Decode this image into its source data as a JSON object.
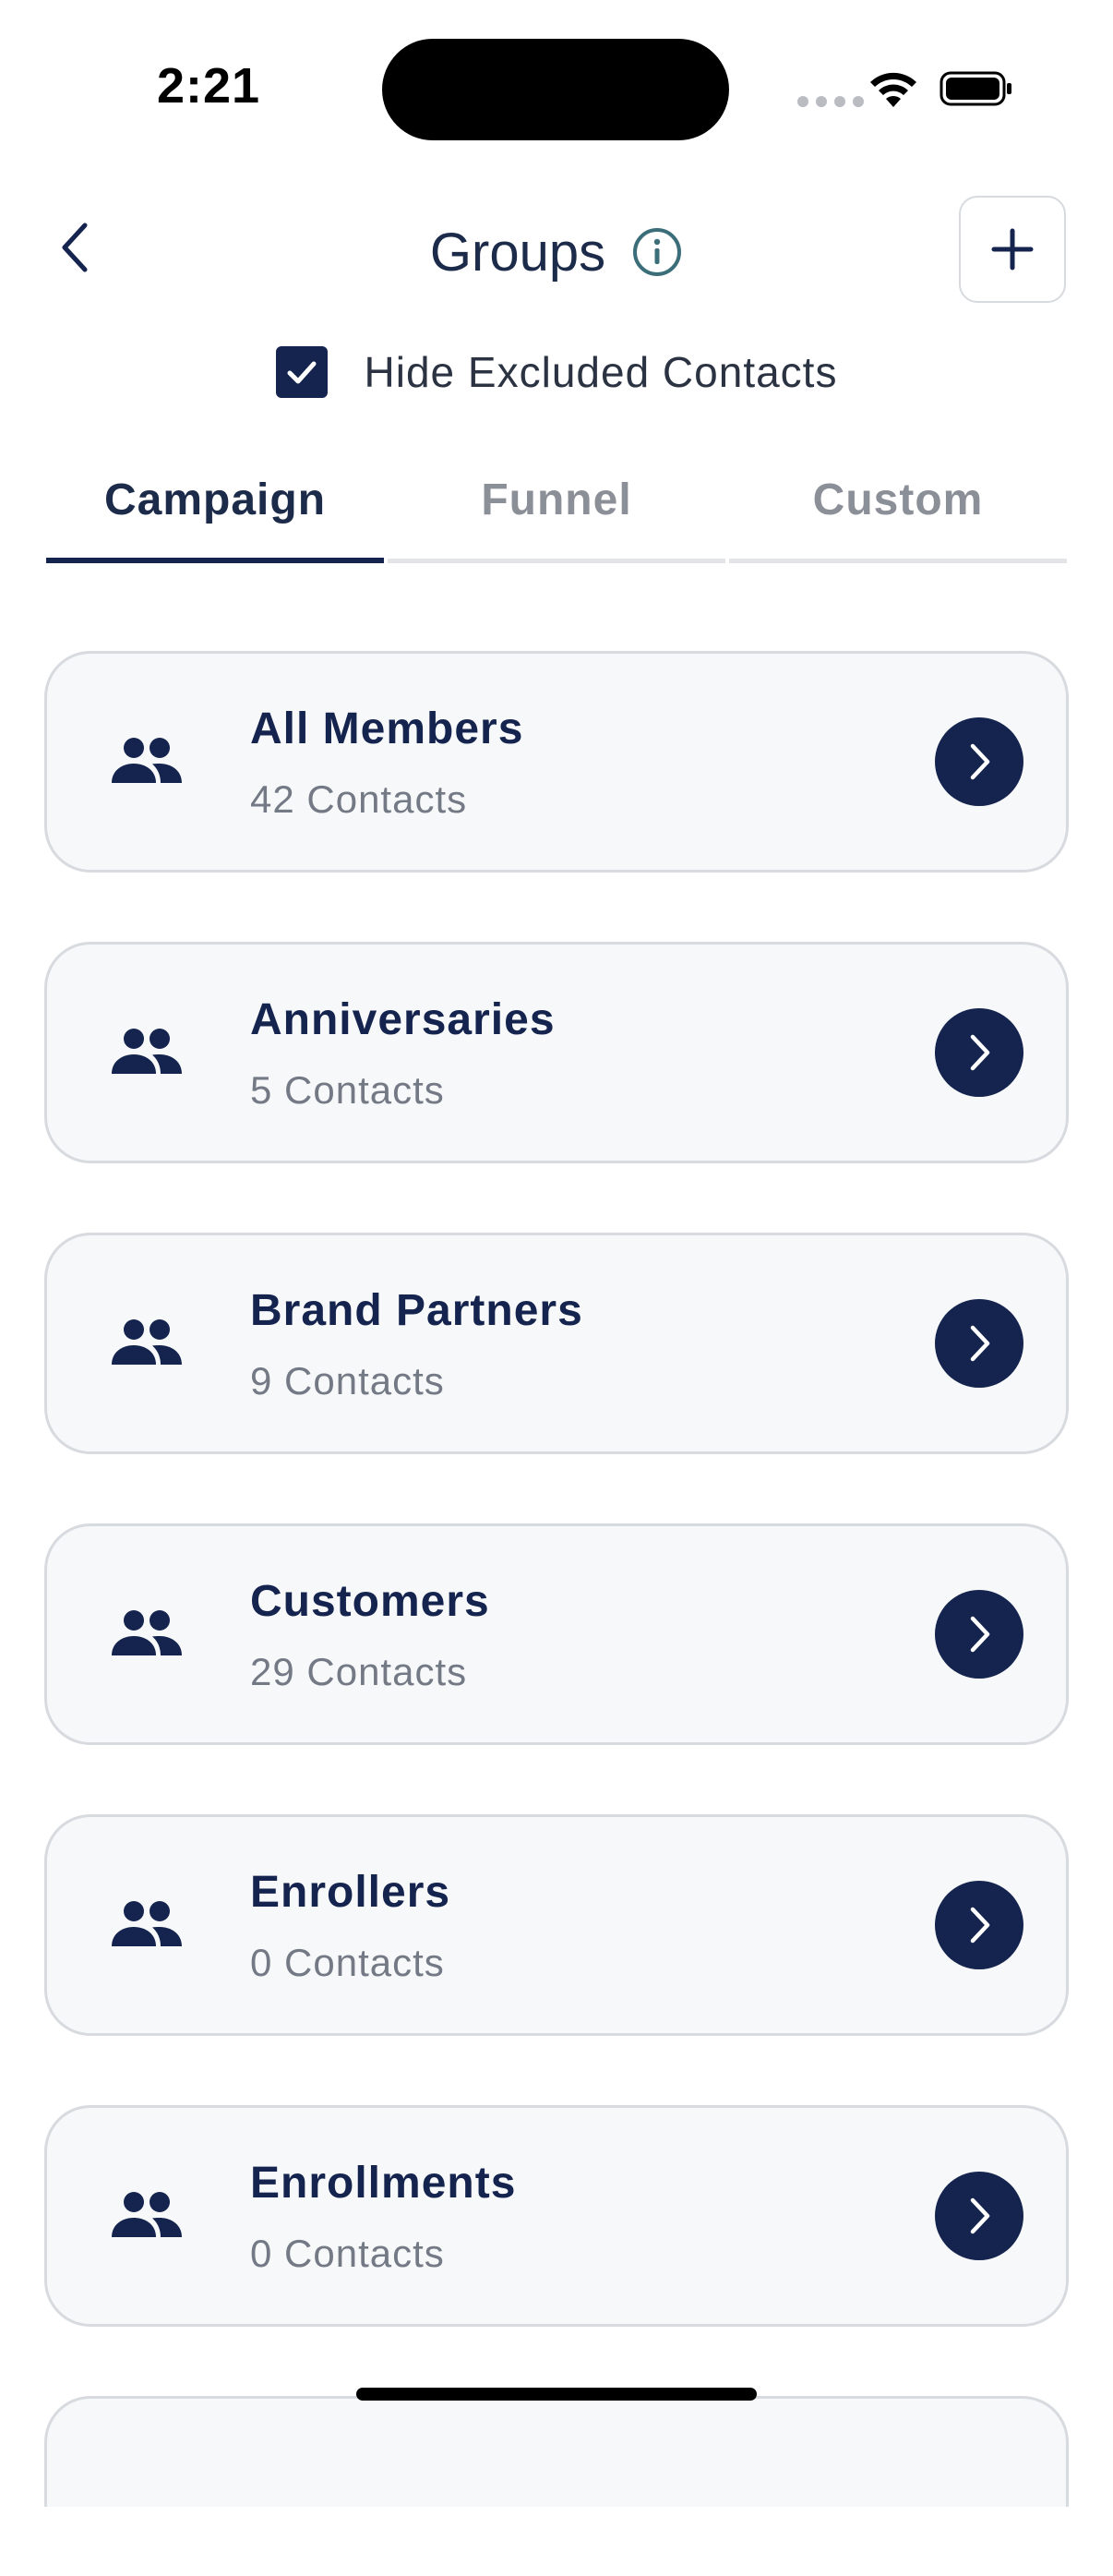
{
  "status_bar": {
    "time": "2:21"
  },
  "header": {
    "title": "Groups",
    "back_icon": "chevron-left-icon",
    "info_icon": "info-icon",
    "add_icon": "plus-icon"
  },
  "filter": {
    "hide_excluded_label": "Hide Excluded Contacts",
    "hide_excluded_checked": true
  },
  "tabs": [
    {
      "label": "Campaign",
      "active": true
    },
    {
      "label": "Funnel",
      "active": false
    },
    {
      "label": "Custom",
      "active": false
    }
  ],
  "groups": [
    {
      "name": "All Members",
      "count": "42 Contacts"
    },
    {
      "name": "Anniversaries",
      "count": "5 Contacts"
    },
    {
      "name": "Brand Partners",
      "count": "9 Contacts"
    },
    {
      "name": "Customers",
      "count": "29 Contacts"
    },
    {
      "name": "Enrollers",
      "count": "0 Contacts"
    },
    {
      "name": "Enrollments",
      "count": "0 Contacts"
    }
  ],
  "colors": {
    "primary": "#14244e",
    "card_bg": "#f7f8f9",
    "card_border": "#d7dade",
    "muted_text": "#737985",
    "info_accent": "#3c6e7a"
  }
}
